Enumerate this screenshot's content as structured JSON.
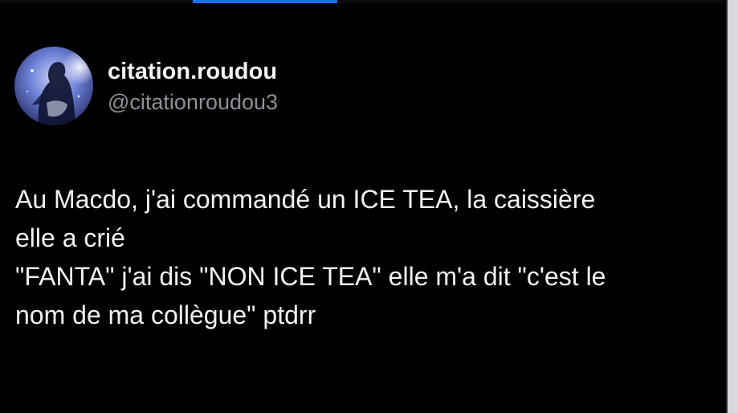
{
  "tweet": {
    "author": {
      "display_name": "citation.roudou",
      "handle": "@citationroudou3",
      "avatar": "avatar-photo"
    },
    "text_lines": [
      "Au Macdo, j'ai commandé un ICE TEA, la caissière",
      "elle a crié",
      "\"FANTA\" j'ai dis \"NON ICE TEA\" elle m'a dit \"c'est le",
      "nom de ma collègue\" ptdrr"
    ]
  },
  "colors": {
    "background": "#000000",
    "text": "#f2f2f2",
    "handle": "#8b9198",
    "accent": "#1d6ff2"
  }
}
